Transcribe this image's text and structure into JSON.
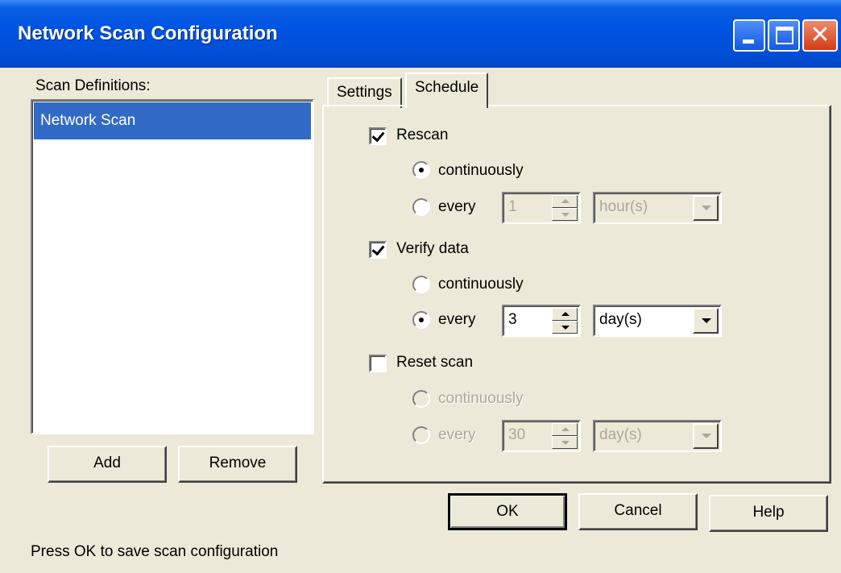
{
  "window": {
    "title": "Network Scan Configuration",
    "minimize_icon": "minimize-icon",
    "maximize_icon": "maximize-icon",
    "close_icon": "close-icon",
    "close_glyph": "✕"
  },
  "scan_definitions": {
    "label": "Scan Definitions:",
    "items": [
      "Network Scan"
    ],
    "selected_index": 0,
    "add_label": "Add",
    "remove_label": "Remove"
  },
  "tabs": [
    {
      "label": "Settings",
      "active": false
    },
    {
      "label": "Schedule",
      "active": true
    }
  ],
  "schedule": {
    "rescan": {
      "label": "Rescan",
      "checked": true,
      "option_continuously": "continuously",
      "option_every": "every",
      "selected": "continuously",
      "interval_value": "1",
      "interval_unit": "hour(s)",
      "interval_enabled": false
    },
    "verify": {
      "label": "Verify data",
      "checked": true,
      "option_continuously": "continuously",
      "option_every": "every",
      "selected": "every",
      "interval_value": "3",
      "interval_unit": "day(s)",
      "interval_enabled": true
    },
    "reset": {
      "label": "Reset scan",
      "checked": false,
      "option_continuously": "continuously",
      "option_every": "every",
      "selected": "none",
      "interval_value": "30",
      "interval_unit": "day(s)",
      "interval_enabled": false
    }
  },
  "buttons": {
    "ok": "OK",
    "cancel": "Cancel",
    "help": "Help"
  },
  "status_text": "Press OK to save scan configuration",
  "colors": {
    "titlebar": "#0054e3",
    "selection": "#316ac5",
    "face": "#ece9d8",
    "close_button": "#d33b14"
  }
}
